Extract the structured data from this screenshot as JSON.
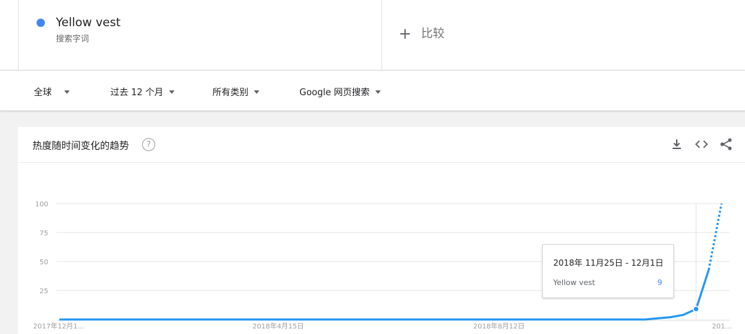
{
  "term": {
    "name": "Yellow vest",
    "subtitle": "搜索字词",
    "color": "#4285f4"
  },
  "compare": {
    "label": "比较"
  },
  "filters": [
    {
      "label": "全球"
    },
    {
      "label": "过去 12 个月"
    },
    {
      "label": "所有类别"
    },
    {
      "label": "Google 网页搜索"
    }
  ],
  "chart_header": {
    "title": "热度随时间变化的趋势"
  },
  "icons": {
    "help": "help-icon",
    "download": "download-icon",
    "embed": "embed-icon",
    "share": "share-icon"
  },
  "tooltip": {
    "date": "2018年 11月25日 - 12月1日",
    "series": "Yellow vest",
    "value": "9"
  },
  "chart_data": {
    "type": "line",
    "title": "热度随时间变化的趋势",
    "xlabel": "",
    "ylabel": "",
    "ylim": [
      0,
      100
    ],
    "y_ticks": [
      100,
      75,
      50,
      25
    ],
    "x_tick_labels": [
      "2017年12月1…",
      "2018年4月15日",
      "2018年8月12日",
      "201…"
    ],
    "grid": true,
    "line_color": "#2196f3",
    "series": [
      {
        "name": "Yellow vest",
        "values": [
          0,
          0,
          0,
          0,
          0,
          0,
          0,
          0,
          0,
          0,
          0,
          0,
          0,
          0,
          0,
          0,
          0,
          0,
          0,
          0,
          0,
          0,
          0,
          0,
          0,
          0,
          0,
          0,
          0,
          0,
          0,
          0,
          0,
          0,
          0,
          0,
          0,
          0,
          0,
          0,
          0,
          0,
          0,
          0,
          0,
          0,
          0,
          1,
          2,
          4,
          9,
          43,
          100
        ],
        "partial_from_index": 51,
        "highlight_index": 50
      }
    ]
  }
}
